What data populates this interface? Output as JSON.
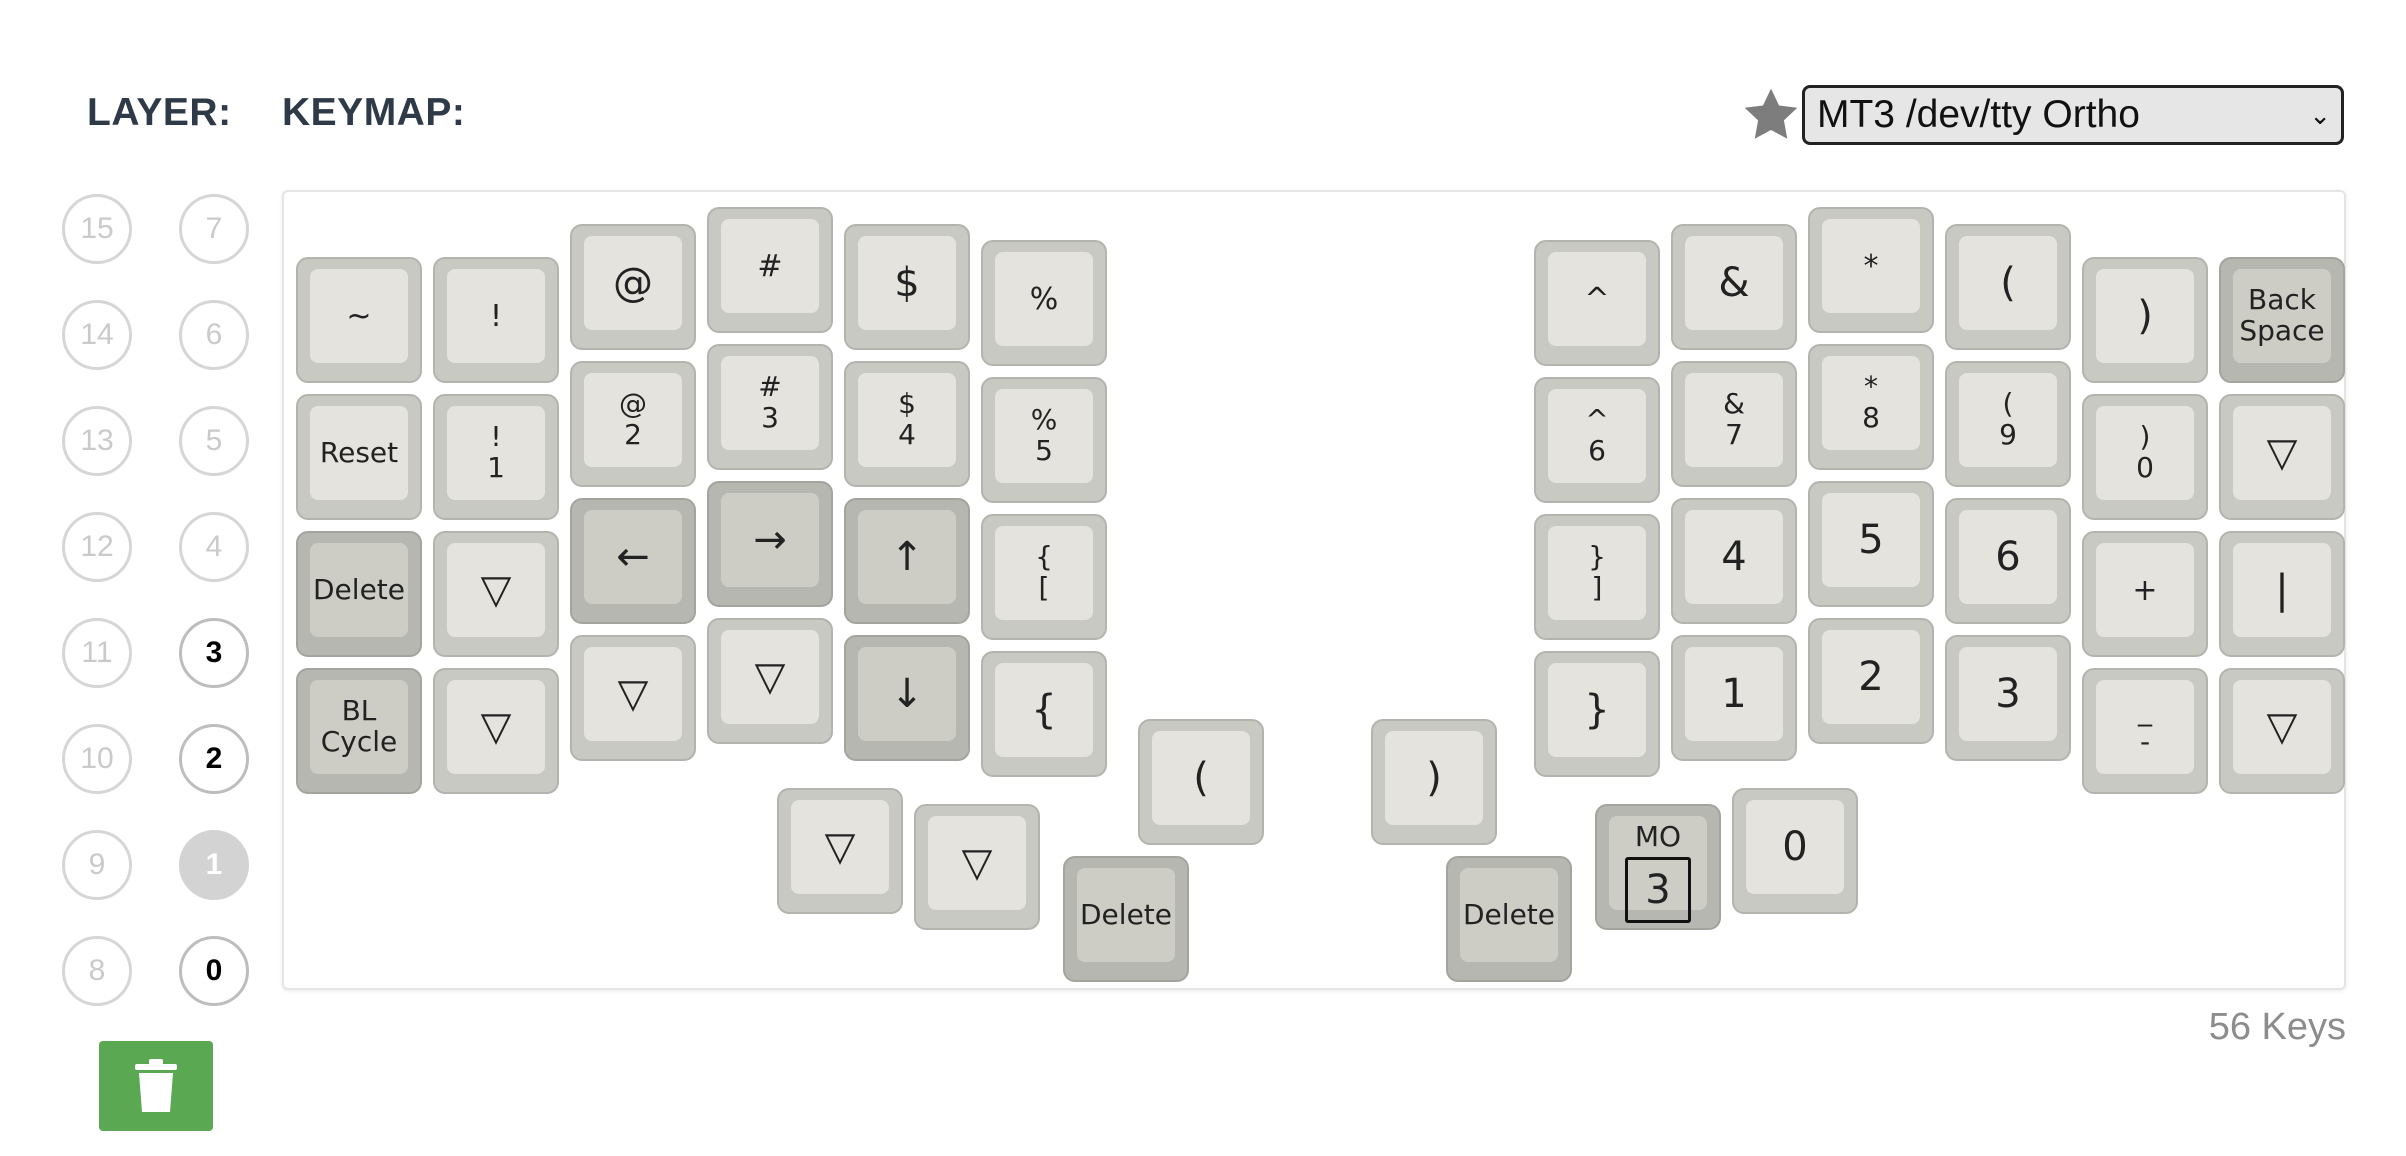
{
  "header": {
    "layer_label": "LAYER:",
    "keymap_label": "KEYMAP:"
  },
  "keyboard_select": {
    "value": "MT3 /dev/tty Ortho",
    "favorite_icon": "star-icon"
  },
  "layers": [
    "15",
    "7",
    "14",
    "6",
    "13",
    "5",
    "12",
    "4",
    "11",
    "3",
    "10",
    "2",
    "9",
    "1",
    "8",
    "0"
  ],
  "layers_active": [
    "3",
    "2",
    "1",
    "0"
  ],
  "layer_selected": "1",
  "keys": [
    {
      "l": "~",
      "f": "f-mid"
    },
    {
      "l": "!",
      "f": "f-mid"
    },
    {
      "l": "@",
      "f": "f-big"
    },
    {
      "l": "#",
      "f": "f-mid"
    },
    {
      "l": "$",
      "f": "f-big"
    },
    {
      "l": "%",
      "f": "f-mid"
    },
    {
      "l": "^",
      "f": "f-mid"
    },
    {
      "l": "&",
      "f": "f-big"
    },
    {
      "l": "*",
      "f": "f-mid"
    },
    {
      "l": "(",
      "f": "f-big"
    },
    {
      "l": ")",
      "f": "f-big"
    },
    {
      "l": "Back\nSpace",
      "f": "f-two",
      "d": true
    },
    {
      "l": "Reset",
      "f": "f-sm"
    },
    {
      "l": "!\n1",
      "f": "f-two"
    },
    {
      "l": "@\n2",
      "f": "f-two"
    },
    {
      "l": "#\n3",
      "f": "f-two"
    },
    {
      "l": "$\n4",
      "f": "f-two"
    },
    {
      "l": "%\n5",
      "f": "f-two"
    },
    {
      "l": "^\n6",
      "f": "f-two"
    },
    {
      "l": "&\n7",
      "f": "f-two"
    },
    {
      "l": "*\n8",
      "f": "f-two"
    },
    {
      "l": "(\n9",
      "f": "f-two"
    },
    {
      "l": ")\n0",
      "f": "f-two"
    },
    {
      "l": "▽",
      "f": "f-big"
    },
    {
      "l": "Delete",
      "f": "f-sm",
      "d": true
    },
    {
      "l": "▽",
      "f": "f-big"
    },
    {
      "l": "←",
      "f": "f-big",
      "d": true
    },
    {
      "l": "→",
      "f": "f-big",
      "d": true
    },
    {
      "l": "↑",
      "f": "f-big",
      "d": true
    },
    {
      "l": "{\n[",
      "f": "f-two"
    },
    {
      "l": "}\n]",
      "f": "f-two"
    },
    {
      "l": "4",
      "f": "f-big"
    },
    {
      "l": "5",
      "f": "f-big"
    },
    {
      "l": "6",
      "f": "f-big"
    },
    {
      "l": "+",
      "f": "f-mid"
    },
    {
      "l": "|",
      "f": "f-big"
    },
    {
      "l": "BL\nCycle",
      "f": "f-two",
      "d": true
    },
    {
      "l": "▽",
      "f": "f-big"
    },
    {
      "l": "▽",
      "f": "f-big"
    },
    {
      "l": "▽",
      "f": "f-big"
    },
    {
      "l": "↓",
      "f": "f-big",
      "d": true
    },
    {
      "l": "{",
      "f": "f-big"
    },
    {
      "l": "}",
      "f": "f-big"
    },
    {
      "l": "1",
      "f": "f-big"
    },
    {
      "l": "2",
      "f": "f-big"
    },
    {
      "l": "3",
      "f": "f-big"
    },
    {
      "l": "_\n-",
      "f": "f-two"
    },
    {
      "l": "▽",
      "f": "f-big"
    },
    {
      "l": "(",
      "f": "f-big"
    },
    {
      "l": ")",
      "f": "f-big"
    },
    {
      "l": "▽",
      "f": "f-big"
    },
    {
      "l": "▽",
      "f": "f-big"
    },
    {
      "l": "Delete",
      "f": "f-sm",
      "d": true
    },
    {
      "l": "Delete",
      "f": "f-sm",
      "d": true
    },
    {
      "l": "MO|3",
      "f": "mo",
      "d": true
    },
    {
      "l": "0",
      "f": "f-big"
    }
  ],
  "key_count": "56 Keys"
}
